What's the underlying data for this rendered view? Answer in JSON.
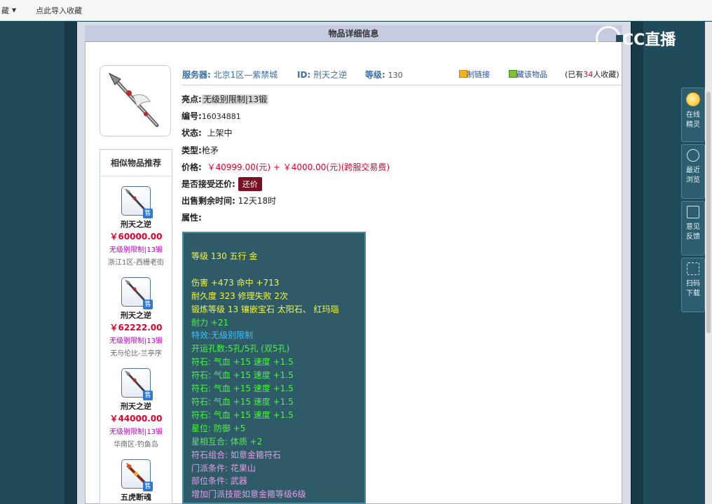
{
  "bookmarks": {
    "folder_label": "藏",
    "import_label": "点此导入收藏"
  },
  "header": {
    "title": "物品详细信息"
  },
  "logo": {
    "text": "CC直播"
  },
  "item_info": {
    "server_label": "服务器:",
    "server_value": "北京1区—紫禁城",
    "id_label": "ID:",
    "id_value": "刑天之逆",
    "level_label": "等级:",
    "level_value": "130",
    "copy_link": "复制链接",
    "favorite": "收藏该物品",
    "fav_prefix": "(已有",
    "fav_count": "34",
    "fav_suffix": "人收藏)"
  },
  "details": {
    "highlight_label": "亮点:",
    "highlight_value": "无级别限制|13锻",
    "number_label": "编号:",
    "number_value": "16034881",
    "status_label": "状态:",
    "status_value": "上架中",
    "type_label": "类型:",
    "type_value": "枪矛",
    "price_label": "价格:",
    "price_value": "￥40999.00(元)  +  ￥4000.00(元)(跨服交易费)",
    "bargain_label": "是否接受还价:",
    "bargain_button": "还价",
    "remaining_label": "出售剩余时间:",
    "remaining_value": "12天18时",
    "attr_label": "属性:"
  },
  "attributes": [
    {
      "text": "等级 130 五行 金",
      "color": "yellow"
    },
    {
      "text": "",
      "color": "yellow"
    },
    {
      "text": "伤害 +473 命中 +713",
      "color": "yellow"
    },
    {
      "text": "耐久度 323 修理失败 2次",
      "color": "yellow"
    },
    {
      "text": "锻炼等级 13 镶嵌宝石 太阳石、 红玛瑙",
      "color": "yellow"
    },
    {
      "text": "耐力 +21",
      "color": "green"
    },
    {
      "text": "特效:无级别限制",
      "color": "cyan"
    },
    {
      "text": "开运孔数:5孔/5孔 (双5孔)",
      "color": "green"
    },
    {
      "text": "符石: 气血 +15 速度 +1.5",
      "color": "green"
    },
    {
      "text": "符石: 气血 +15 速度 +1.5",
      "color": "green"
    },
    {
      "text": "符石: 气血 +15 速度 +1.5",
      "color": "green"
    },
    {
      "text": "符石: 气血 +15 速度 +1.5",
      "color": "green"
    },
    {
      "text": "符石: 气血 +15 速度 +1.5",
      "color": "green"
    },
    {
      "text": "星位: 防御 +5",
      "color": "green"
    },
    {
      "text": "星相互合: 体质 +2",
      "color": "green"
    },
    {
      "text": "符石组合: 如意金箍符石",
      "color": "purple"
    },
    {
      "text": "门派条件: 花果山",
      "color": "purple"
    },
    {
      "text": "部位条件: 武器",
      "color": "purple"
    },
    {
      "text": "增加门派技能如意金箍等级6级",
      "color": "purple"
    }
  ],
  "similar": {
    "title": "相似物品推荐",
    "sale_badge": "售",
    "items": [
      {
        "name": "刑天之逆",
        "price": "￥60000.00",
        "tag": "无级别限制|13锻",
        "server": "浙江1区-西栅老街"
      },
      {
        "name": "刑天之逆",
        "price": "￥62222.00",
        "tag": "无级别限制|13锻",
        "server": "无与伦比-兰亭序"
      },
      {
        "name": "刑天之逆",
        "price": "￥44000.00",
        "tag": "无级别限制|13锻",
        "server": "华南区-钓鱼岛"
      },
      {
        "name": "五虎断魂",
        "price": "",
        "tag": "",
        "server": ""
      }
    ]
  },
  "floatbar": [
    {
      "label1": "在线",
      "label2": "精灵",
      "icon": "avatar-icon"
    },
    {
      "label1": "最近",
      "label2": "浏览",
      "icon": "clock-icon"
    },
    {
      "label1": "意见",
      "label2": "反馈",
      "icon": "edit-icon"
    },
    {
      "label1": "扫码",
      "label2": "下载",
      "icon": "scan-icon"
    }
  ]
}
